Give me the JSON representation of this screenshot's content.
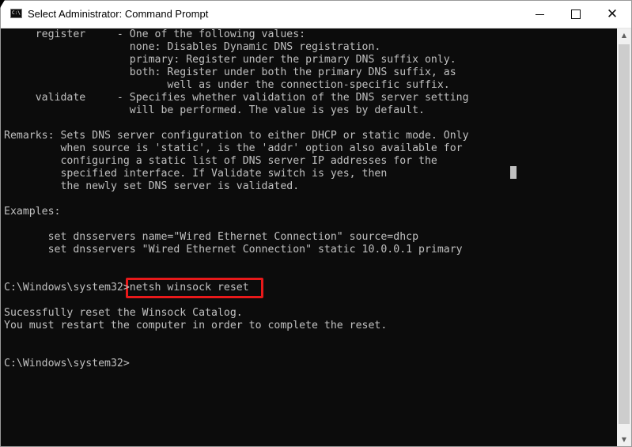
{
  "window": {
    "title": "Select Administrator: Command Prompt",
    "icon_label": "C:\\"
  },
  "controls": {
    "minimize_icon": "minimize-icon",
    "maximize_icon": "maximize-icon",
    "close_glyph": "✕"
  },
  "console": {
    "lines": [
      "     register     - One of the following values:",
      "                    none: Disables Dynamic DNS registration.",
      "                    primary: Register under the primary DNS suffix only.",
      "                    both: Register under both the primary DNS suffix, as",
      "                          well as under the connection-specific suffix.",
      "     validate     - Specifies whether validation of the DNS server setting",
      "                    will be performed. The value is yes by default.",
      "",
      "Remarks: Sets DNS server configuration to either DHCP or static mode. Only",
      "         when source is 'static', is the 'addr' option also available for",
      "         configuring a static list of DNS server IP addresses for the",
      "         specified interface. If Validate switch is yes, then",
      "         the newly set DNS server is validated.",
      "",
      "Examples:",
      "",
      "       set dnsservers name=\"Wired Ethernet Connection\" source=dhcp",
      "       set dnsservers \"Wired Ethernet Connection\" static 10.0.0.1 primary",
      "",
      "",
      "C:\\Windows\\system32>netsh winsock reset",
      "",
      "Sucessfully reset the Winsock Catalog.",
      "You must restart the computer in order to complete the reset.",
      "",
      "",
      "C:\\Windows\\system32>"
    ],
    "highlighted_command": "netsh winsock reset",
    "highlight_color": "#e8191a",
    "text_color": "#c0c0c0",
    "background_color": "#0c0c0c"
  },
  "scrollbar": {
    "up_glyph": "▲",
    "down_glyph": "▼"
  }
}
